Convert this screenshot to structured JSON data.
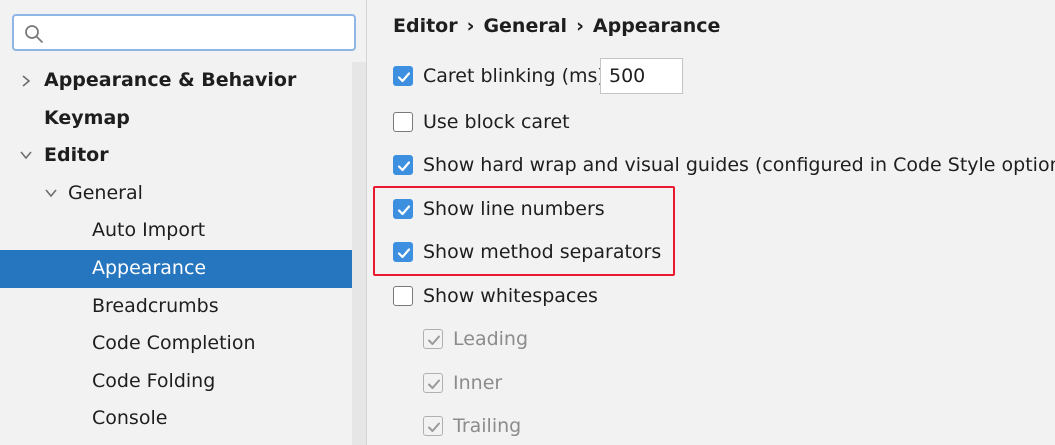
{
  "search": {
    "placeholder": "",
    "value": ""
  },
  "sidebar": {
    "items": [
      {
        "label": "Appearance & Behavior",
        "expanded": false,
        "bold": true
      },
      {
        "label": "Keymap",
        "bold": true
      },
      {
        "label": "Editor",
        "expanded": true,
        "bold": true
      },
      {
        "label": "General",
        "expanded": true
      },
      {
        "label": "Auto Import"
      },
      {
        "label": "Appearance",
        "selected": true
      },
      {
        "label": "Breadcrumbs"
      },
      {
        "label": "Code Completion"
      },
      {
        "label": "Code Folding"
      },
      {
        "label": "Console"
      }
    ]
  },
  "breadcrumb": {
    "items": [
      "Editor",
      "General",
      "Appearance"
    ],
    "separator": "›"
  },
  "options": {
    "caret_blinking": {
      "label": "Caret blinking (ms):",
      "checked": true,
      "value": "500"
    },
    "block_caret": {
      "label": "Use block caret",
      "checked": false
    },
    "hard_wrap": {
      "label": "Show hard wrap and visual guides (configured in Code Style options)",
      "checked": true
    },
    "line_numbers": {
      "label": "Show line numbers",
      "checked": true
    },
    "method_separators": {
      "label": "Show method separators",
      "checked": true
    },
    "whitespaces": {
      "label": "Show whitespaces",
      "checked": false
    },
    "leading": {
      "label": "Leading",
      "checked": true,
      "disabled": true
    },
    "inner": {
      "label": "Inner",
      "checked": true,
      "disabled": true
    },
    "trailing": {
      "label": "Trailing",
      "checked": true,
      "disabled": true
    }
  },
  "colors": {
    "selection": "#2675bf",
    "checkbox_checked": "#3d8fe0",
    "highlight_border": "#e8192c",
    "search_focus_border": "#8fb7e5"
  }
}
